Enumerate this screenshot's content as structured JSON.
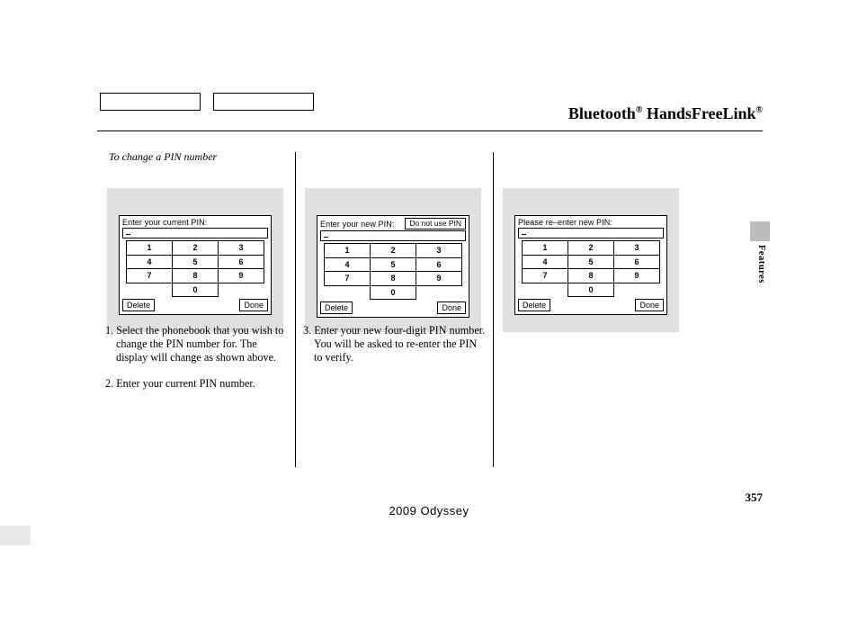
{
  "header": {
    "title_1": "Bluetooth",
    "reg": "®",
    "title_2": " HandsFreeLink"
  },
  "section_label": "To change a PIN number",
  "keypad": {
    "keys": [
      "1",
      "2",
      "3",
      "4",
      "5",
      "6",
      "7",
      "8",
      "9",
      "0"
    ],
    "delete": "Delete",
    "done": "Done"
  },
  "screens": [
    {
      "prompt": "Enter your current PIN:",
      "aux": ""
    },
    {
      "prompt": "Enter your new PIN:",
      "aux": "Do not use PIN"
    },
    {
      "prompt": "Please re–enter new PIN:",
      "aux": ""
    }
  ],
  "steps": {
    "s1": "1. Select the phonebook that you wish to change the PIN number for. The display will change as shown above.",
    "s2": "2. Enter your current PIN number.",
    "s3": "3. Enter your new four-digit PIN number. You will be asked to re-enter the PIN to verify."
  },
  "page_number": "357",
  "footer": "2009  Odyssey",
  "side_tab": "Features"
}
